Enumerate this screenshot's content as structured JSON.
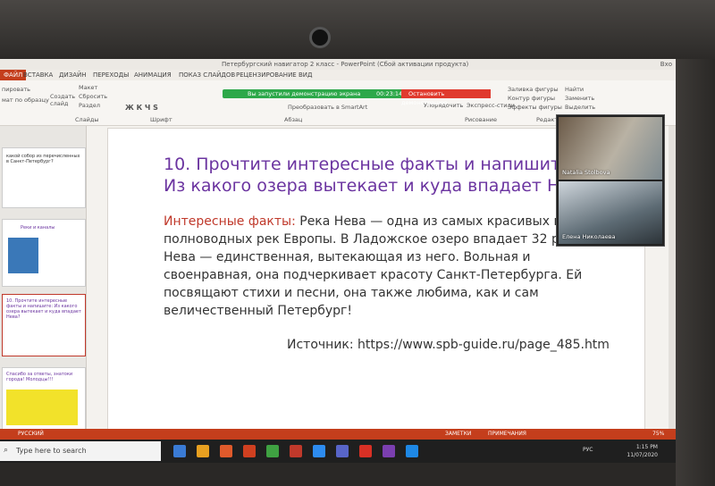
{
  "window": {
    "title": "Петербургский навигатор 2 класс - PowerPoint (Сбой активации продукта)",
    "right_label": "Вхо"
  },
  "ribbon_tabs": [
    "ФАЙЛ",
    "ВСТАВКА",
    "ДИЗАЙН",
    "ПЕРЕХОДЫ",
    "АНИМАЦИЯ",
    "ПОКАЗ СЛАЙДОВ",
    "РЕЦЕНЗИРОВАНИЕ",
    "ВИД"
  ],
  "ribbon": {
    "copy": "пировать",
    "format_painter": "мат по образцу",
    "create_slide": "Создать слайд",
    "layout": "Макет",
    "reset": "Сбросить",
    "section": "Раздел",
    "group_slides": "Слайды",
    "group_font": "Шрифт",
    "group_paragraph": "Абзац",
    "smartart": "Преобразовать в SmartArt",
    "arrange": "Упорядочить",
    "quick_styles": "Экспресс-стили",
    "fill": "Заливка фигуры",
    "outline": "Контур фигуры",
    "effects": "Эффекты фигуры",
    "find": "Найти",
    "replace": "Заменить",
    "select": "Выделить",
    "group_editing": "Редактирование",
    "group_drawing": "Рисование"
  },
  "share_bar": {
    "message": "Вы запустили демонстрацию экрана",
    "timer": "00:23:14",
    "stop_label": "Остановить демонстрацию"
  },
  "thumbnails": [
    {
      "text": "какой собор из перечисленных в Санкт-Петербург?"
    },
    {
      "text": "Реки и каналы"
    },
    {
      "text": "10. Прочтите интересные факты и напишите: Из какого озера вытекает и куда впадает Нева?"
    },
    {
      "text": "Спасибо за ответы, знатоки города! Молодцы!!!"
    }
  ],
  "slide": {
    "title_line1": "10. Прочтите интересные факты и напишите",
    "title_line2": "Из какого озера вытекает и куда впадает Не",
    "label": "Интересные факты:",
    "body_line1": "  Река Нева — одна из самых красивых и",
    "body_line2": "полноводных рек Европы. В Ладожское озеро впадает 32 ре",
    "body_line3": "Нева — единственная, вытекающая из него. Вольная и",
    "body_line4": "своенравная, она подчеркивает красоту Санкт-Петербурга. Ей",
    "body_line5": "посвящают стихи и песни, она также любима, как и сам",
    "body_line6": "величественный Петербург!",
    "source": "Источник: https://www.spb-guide.ru/page_485.htm"
  },
  "video": {
    "participant1": "Natalia Stolbova",
    "participant2": "Елена Николаева"
  },
  "status_bar": {
    "language": "РУССКИЙ",
    "notes": "ЗАМЕТКИ",
    "comments": "ПРИМЕЧАНИЯ",
    "zoom": "75%"
  },
  "taskbar": {
    "search_placeholder": "Type here to search",
    "lang": "РУС",
    "time": "1:15 PM",
    "date": "11/07/2020"
  }
}
